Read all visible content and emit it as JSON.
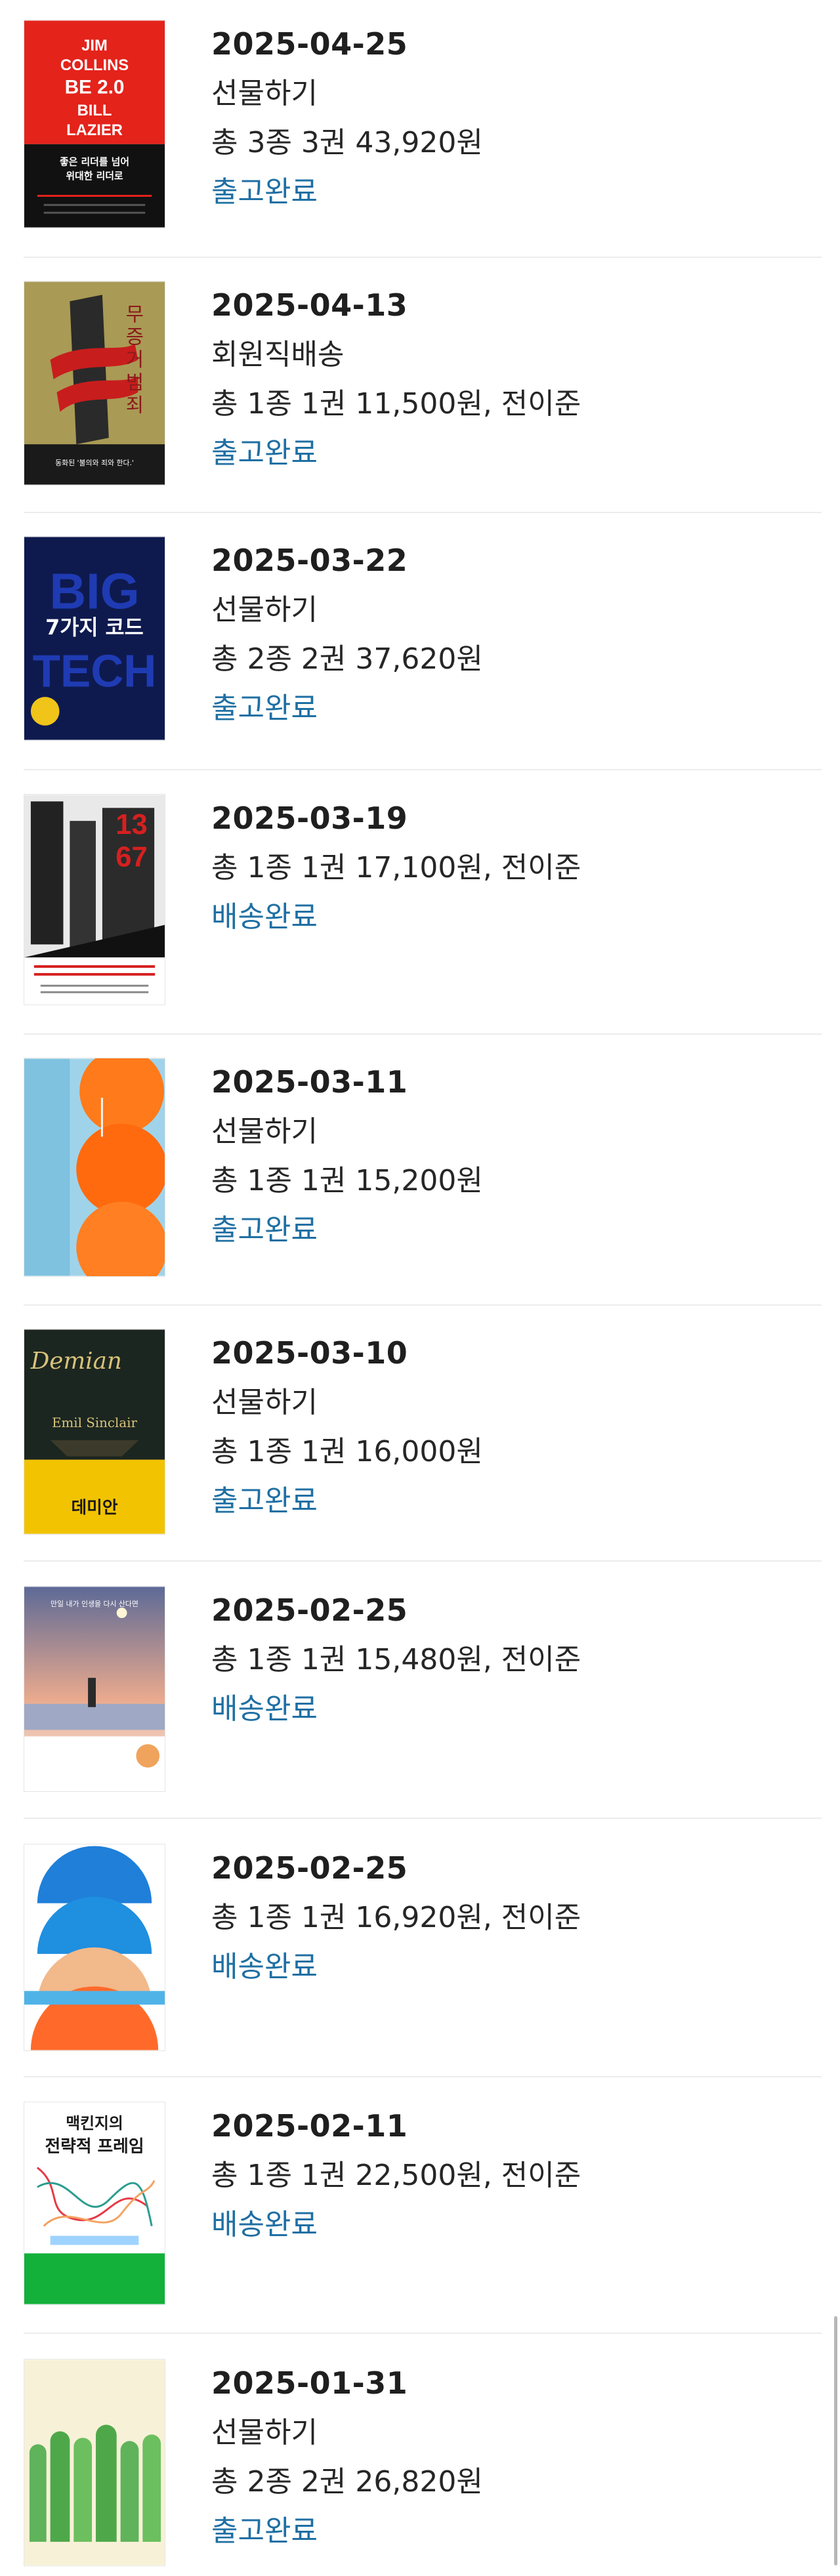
{
  "orders": [
    {
      "date": "2025-04-25",
      "type": "선물하기",
      "summary": "총 3종 3권 43,920원",
      "status": "출고완료",
      "cover": {
        "title_lines": [
          "JIM",
          "COLLINS",
          "BE 2.0",
          "BILL",
          "LAZIER"
        ],
        "subtitle": "좋은 리더를 넘어",
        "subtitle2": "위대한 리더로"
      }
    },
    {
      "date": "2025-04-13",
      "type": "회원직배송",
      "summary": "총 1종 1권 11,500원, 전이준",
      "status": "출고완료",
      "cover": {
        "title_lines": [
          "무",
          "증",
          "거",
          "범",
          "죄"
        ],
        "subtitle": "동화된 '불의와 죄와 한다.'"
      }
    },
    {
      "date": "2025-03-22",
      "type": "선물하기",
      "summary": "총 2종 2권 37,620원",
      "status": "출고완료",
      "cover": {
        "title_lines": [
          "BIG",
          "TECH"
        ],
        "subtitle": "7가지 코드"
      }
    },
    {
      "date": "2025-03-19",
      "type": "",
      "summary": "총 1종 1권 17,100원, 전이준",
      "status": "배송완료",
      "cover": {
        "title_lines": [
          "13",
          "67"
        ]
      }
    },
    {
      "date": "2025-03-11",
      "type": "선물하기",
      "summary": "총 1종 1권 15,200원",
      "status": "출고완료",
      "cover": {}
    },
    {
      "date": "2025-03-10",
      "type": "선물하기",
      "summary": "총 1종 1권 16,000원",
      "status": "출고완료",
      "cover": {
        "title_lines": [
          "Demian",
          "Emil Sinclair"
        ],
        "subtitle": "데미안"
      }
    },
    {
      "date": "2025-02-25",
      "type": "",
      "summary": "총 1종 1권 15,480원, 전이준",
      "status": "배송완료",
      "cover": {
        "title_lines": [
          "만일 내가 인생을 다시 산다면"
        ]
      }
    },
    {
      "date": "2025-02-25",
      "type": "",
      "summary": "총 1종 1권 16,920원, 전이준",
      "status": "배송완료",
      "cover": {}
    },
    {
      "date": "2025-02-11",
      "type": "",
      "summary": "총 1종 1권 22,500원, 전이준",
      "status": "배송완료",
      "cover": {
        "title_lines": [
          "맥킨지의",
          "전략적 프레임"
        ]
      }
    },
    {
      "date": "2025-01-31",
      "type": "선물하기",
      "summary": "총 2종 2권 26,820원",
      "status": "출고완료",
      "cover": {}
    }
  ]
}
